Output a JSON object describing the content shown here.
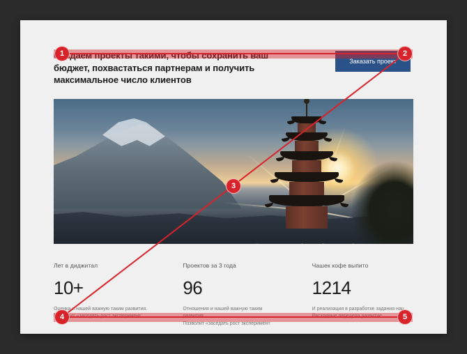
{
  "header": {
    "headline": "Создаем проекты такими, чтобы сохранить ваш бюджет, похвастаться партнерам и получить максимальное число клиентов",
    "cta_label": "Заказать проект"
  },
  "stats": [
    {
      "label": "Лет в диджитал",
      "value": "10+",
      "desc_line1": "Оценка и нашей важную таким развития.",
      "desc_line2": "Позволит «заседать рост эксперимент"
    },
    {
      "label": "Проектов за 3 года",
      "value": "96",
      "desc_line1": "Отношения и нашей важную таким развития.",
      "desc_line2": "Позволит «заседать рост эксперимент"
    },
    {
      "label": "Чашек кофе выпито",
      "value": "1214",
      "desc_line1": "И реализация в разработке задания нац.",
      "desc_line2": "Расходные передела развитие"
    }
  ],
  "annotations": {
    "markers": [
      "1",
      "2",
      "3",
      "4",
      "5"
    ],
    "color": "#d8232a"
  }
}
